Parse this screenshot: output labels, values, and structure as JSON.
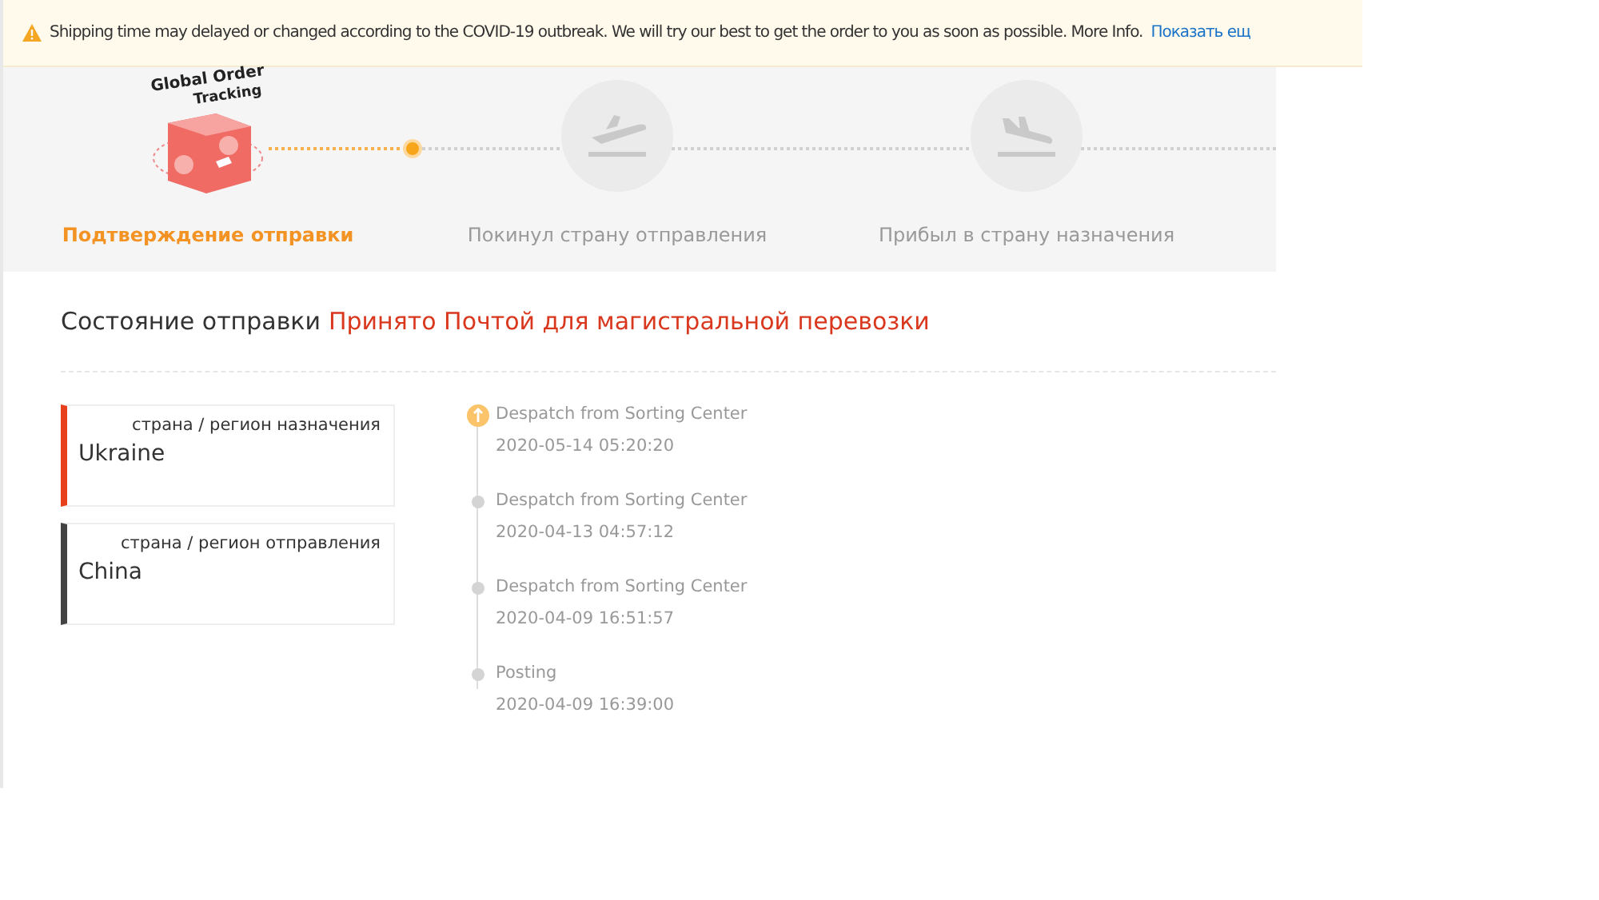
{
  "notice": {
    "text": "Shipping time may delayed or changed according to the COVID-19 outbreak. We will try our best to get the order to you as soon as possible. More Info.",
    "link": "Показать ещ"
  },
  "logo": {
    "line1": "Global Order",
    "line2": "Tracking"
  },
  "steps": [
    {
      "kind": "logo",
      "label": "Подтверждение отправки",
      "active": true
    },
    {
      "kind": "departure",
      "label": "Покинул страну отправления",
      "active": false
    },
    {
      "kind": "arrival",
      "label": "Прибыл в страну назначения",
      "active": false
    }
  ],
  "status": {
    "label": "Состояние отправки",
    "value": "Принято Почтой для магистральной перевозки"
  },
  "places": [
    {
      "label": "страна / регион назначения",
      "value": "Ukraine",
      "color": "#e8401c"
    },
    {
      "label": "страна / регион отправления",
      "value": "China",
      "color": "#444444"
    }
  ],
  "events": [
    {
      "event": "Despatch from Sorting Center",
      "time": "2020-05-14 05:20:20",
      "current": true
    },
    {
      "event": "Despatch from Sorting Center",
      "time": "2020-04-13 04:57:12",
      "current": false
    },
    {
      "event": "Despatch from Sorting Center",
      "time": "2020-04-09 16:51:57",
      "current": false
    },
    {
      "event": "Posting",
      "time": "2020-04-09 16:39:00",
      "current": false
    }
  ]
}
